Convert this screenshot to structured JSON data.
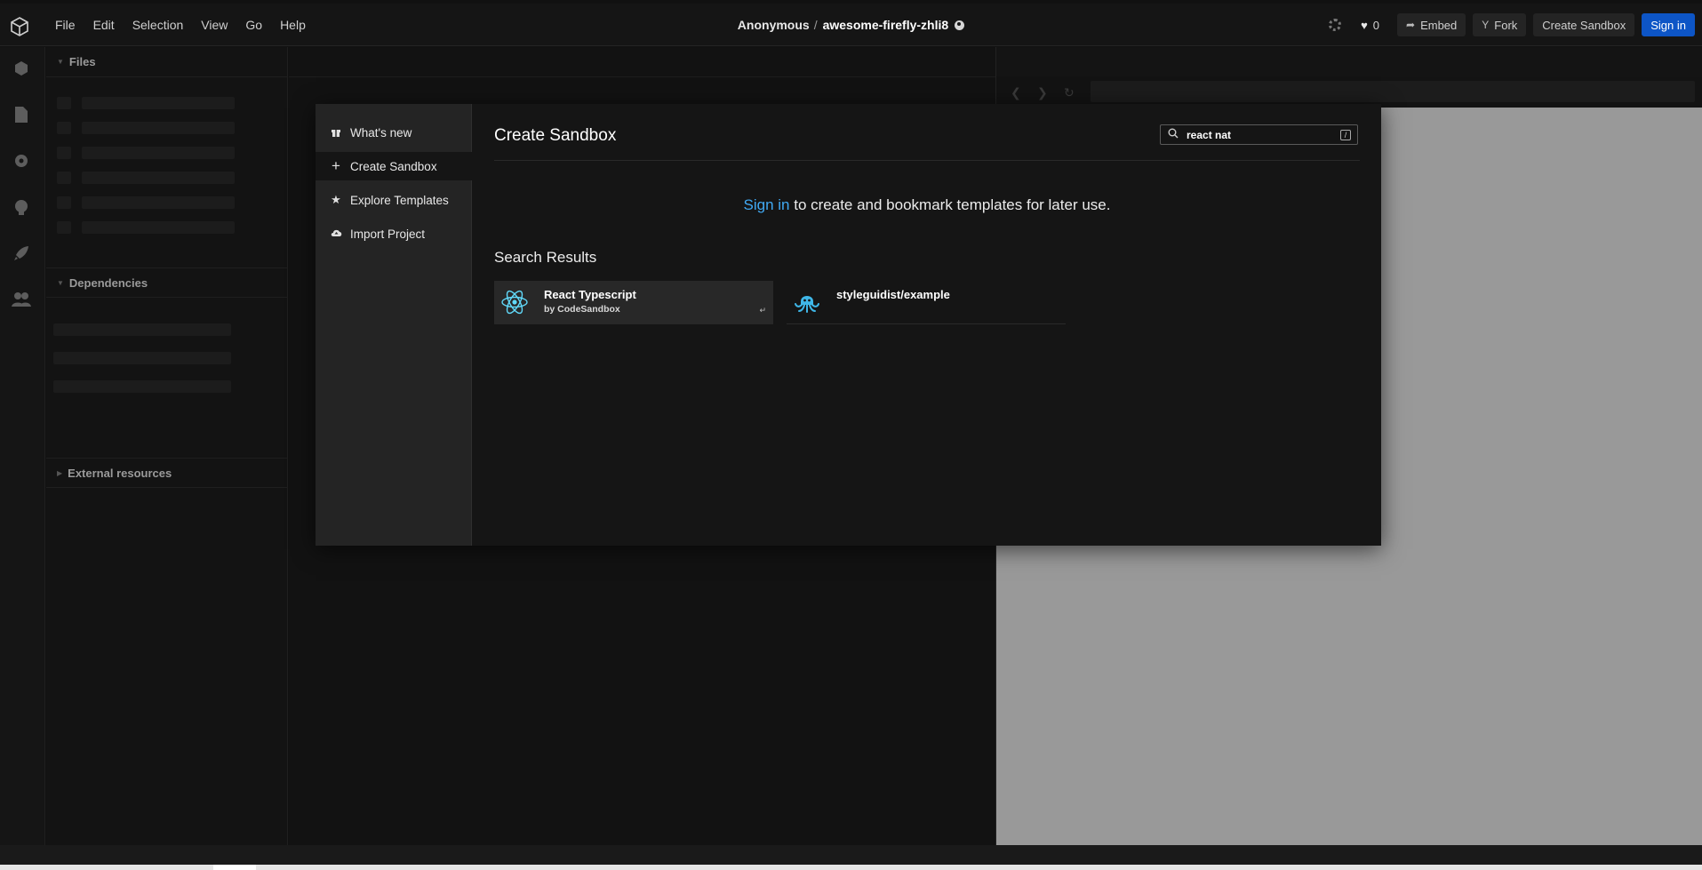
{
  "menubar": {
    "items": [
      "File",
      "Edit",
      "Selection",
      "View",
      "Go",
      "Help"
    ]
  },
  "breadcrumb": {
    "owner": "Anonymous",
    "separator": "/",
    "sandbox_name": "awesome-firefly-zhli8"
  },
  "header_actions": {
    "likes_count": "0",
    "embed_label": "Embed",
    "fork_label": "Fork",
    "create_sandbox_label": "Create Sandbox",
    "sign_in_label": "Sign in"
  },
  "activity_icons": [
    "cube-icon",
    "file-icon",
    "gear-icon",
    "github-icon",
    "rocket-icon",
    "users-icon"
  ],
  "explorer": {
    "files_label": "Files",
    "dependencies_label": "Dependencies",
    "external_resources_label": "External resources"
  },
  "modal": {
    "nav": [
      {
        "label": "What's new",
        "icon": "gift-icon"
      },
      {
        "label": "Create Sandbox",
        "icon": "plus-icon"
      },
      {
        "label": "Explore Templates",
        "icon": "star-icon"
      },
      {
        "label": "Import Project",
        "icon": "cloud-upload-icon"
      }
    ],
    "title": "Create Sandbox",
    "search_value": "react nat",
    "search_shortcut": "/",
    "signin_link": "Sign in",
    "signin_rest": " to create and bookmark templates for later use.",
    "results_heading": "Search Results",
    "results": [
      {
        "name": "React Typescript",
        "by": "by CodeSandbox",
        "icon": "react-icon",
        "enter_hint": "↵"
      },
      {
        "name": "styleguidist/example",
        "by": "",
        "icon": "octopus-icon"
      }
    ]
  },
  "colors": {
    "accent_blue": "#0d55c6",
    "link_blue": "#40a9f3",
    "react_cyan": "#61dafb"
  }
}
